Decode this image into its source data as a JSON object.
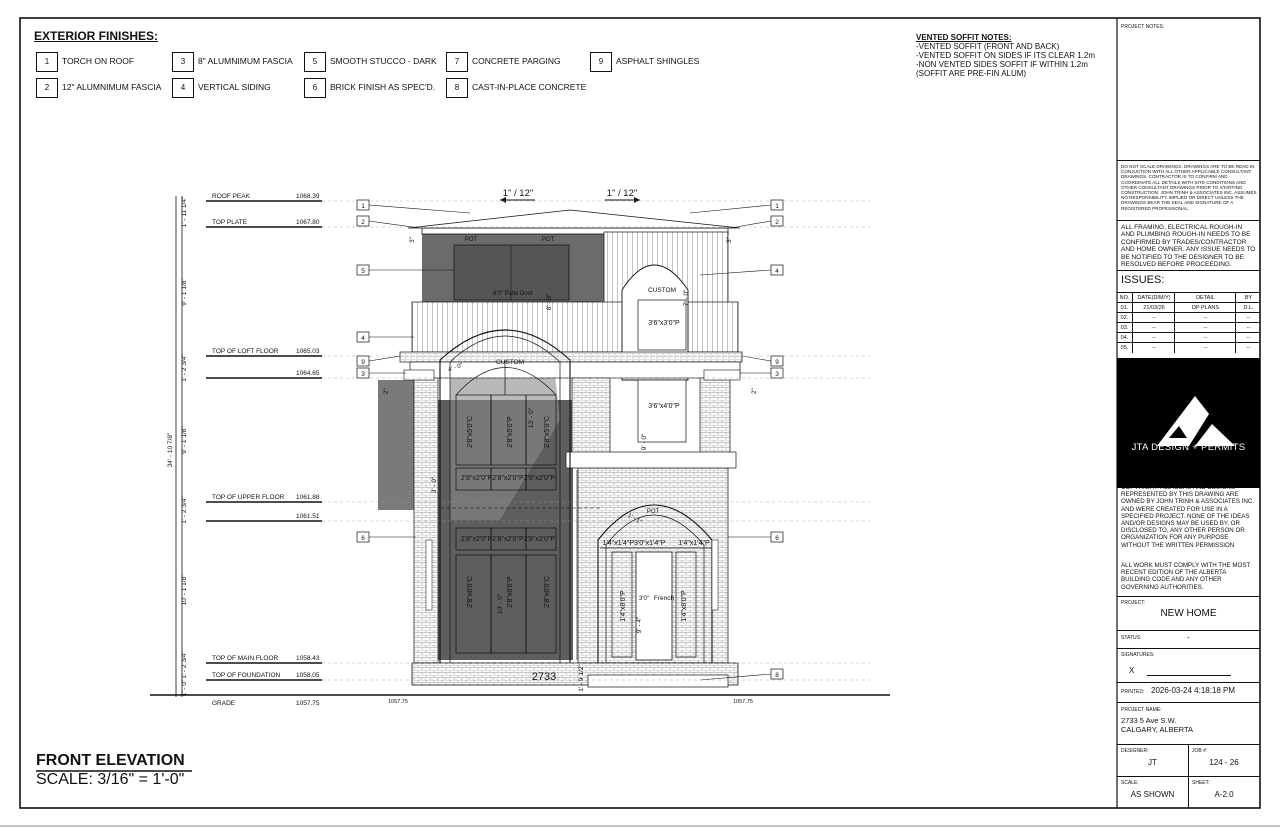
{
  "exterior_finishes": {
    "title": "EXTERIOR FINISHES:",
    "items": [
      {
        "num": "1",
        "label": "TORCH ON  ROOF"
      },
      {
        "num": "2",
        "label": "12\" ALUMNIMUM FASCIA"
      },
      {
        "num": "3",
        "label": "8\" ALUMNIMUM FASCIA"
      },
      {
        "num": "4",
        "label": "VERTICAL SIDING"
      },
      {
        "num": "5",
        "label": "SMOOTH STUCCO - DARK"
      },
      {
        "num": "6",
        "label": "BRICK FINISH AS SPEC'D."
      },
      {
        "num": "7",
        "label": "CONCRETE PARGING"
      },
      {
        "num": "8",
        "label": "CAST-IN-PLACE CONCRETE"
      },
      {
        "num": "9",
        "label": "ASPHALT SHINGLES"
      }
    ]
  },
  "soffit_notes": {
    "title": "VENTED SOFFIT NOTES:",
    "lines": [
      "-VENTED SOFFIT (FRONT AND BACK)",
      "-VENTED SOFFIT ON SIDES IF ITS CLEAR 1.2m",
      "-NON VENTED SIDES SOFFIT IF WITHIN 1.2m",
      "(SOFFIT ARE PRE-FIN ALUM)"
    ]
  },
  "drawing": {
    "title": "FRONT ELEVATION",
    "scale": "SCALE: 3/16\" = 1'-0\"",
    "address_number": "2733",
    "roof_slopes": [
      "1\" / 12\"",
      "1\" / 12\""
    ],
    "levels": [
      {
        "name": "ROOF PEAK",
        "elev": "1068.39"
      },
      {
        "name": "TOP PLATE",
        "elev": "1067.80"
      },
      {
        "name": "TOP OF LOFT FLOOR",
        "elev": "1065.03"
      },
      {
        "name": "",
        "elev": "1064.65"
      },
      {
        "name": "TOP OF UPPER FLOOR",
        "elev": "1061.88"
      },
      {
        "name": "",
        "elev": "1061.51"
      },
      {
        "name": "TOP OF MAIN FLOOR",
        "elev": "1058.43"
      },
      {
        "name": "TOP OF FOUNDATION",
        "elev": "1058.05"
      },
      {
        "name": "GRADE",
        "elev": "1057.75"
      }
    ],
    "grade_side_labels": [
      "1057.75",
      "1057.75"
    ],
    "dimensions": {
      "overall": "34' - 10 7/8\"",
      "roof": "1' - 11 1/4\"",
      "loft": "9' - 1 1/8\"",
      "loft_floor": "1' - 2 3/4\"",
      "upper": "9' - 1 1/8\"",
      "upper_floor": "1' - 2 3/4\"",
      "main": "10' - 1 1/8\"",
      "main_floor": "1' - 2 3/4\"",
      "foundation": "1' - 0\"",
      "entry_step": "1' - 9 1/2\""
    },
    "callouts_left": [
      "1",
      "2",
      "5",
      "4",
      "9",
      "3",
      "6"
    ],
    "callouts_right": [
      "1",
      "2",
      "4",
      "9",
      "3",
      "6",
      "8"
    ],
    "window_labels": {
      "patio_door": "8'0\" Patio Door",
      "pot1": "POT",
      "pot2": "POT",
      "pot3": "POT",
      "custom1": "CUSTOM",
      "custom2": "CUSTOM",
      "w_3x3": "3'6\"x3'0\"P",
      "w_3x4": "3'6\"x4'0\"P",
      "w_25c_a": "2'8\"x5'0\"C",
      "w_25p": "2'8\"x5'0\"P",
      "w_25c_b": "2'8\"x5'0\"C",
      "transom_row1": "2'8\"x2'0\"P2'8\"x2'0\"P2'8\"x2'0\"P",
      "transom_row2": "2'8\"x2'0\"P2'8\"x2'0\"P2'8\"x2'0\"P",
      "w_26c_a": "2'8\"x6'0\"C",
      "w_26p": "2'8\"x6'0\"P",
      "w_26c_b": "2'8\"x6'0\"C",
      "entry_transom": "1'4\"x1'4\"P3'0\"x1'4\"P",
      "entry_transom_r": "1'4\"x1'4\"P",
      "sidelite_l": "1'4\"x8'0\"P",
      "sidelite_r": "1'4\"x8'0\"P",
      "french": "French",
      "door_w": "3'0\"",
      "d_13": "13' - 0\"",
      "d_8": "8' - 0\"",
      "d_7": "7' - 0\"",
      "d_9": "9' - 0\"",
      "d_3": "3' - 0\"",
      "d_10": "10' - 0\"",
      "d_94": "9' - 4\"",
      "d_4": "4' - 0\"",
      "d_1": "1' - 1\"",
      "d_2a": "2\"",
      "d_2b": "2\"",
      "d_3a": "3\"",
      "d_3b": "3\""
    }
  },
  "title_block": {
    "project_notes_label": "PROJECT NOTES:",
    "disclaimer": "DO NOT SCALE DRAWINGS. DRAWINGS ARE TO BE READ IN CONJUCTION WITH ALL OTHER APPLICABLE CONSULTANT DRAWINGS. CONTRACTOR IS TO CONFIRM AND COORDINATE ALL DETAILS WITH SITE CONDITIONS AND OTHER CONSULTANT DRAWINGS PRIOR TO STARTING CONSTRUCTION. JOHN TRINH & ASSOCIATES INC. ASSUMES NO RESPONSIBILITY, IMPLIED OR DIRECT UNLESS THE DRAWINGS BEAR THE SEAL AND SIGNATURE OF A REGISTERED PROFESSIONAL.",
    "framing_note": "ALL FRAMING, ELECTRICAL ROUGH-IN AND PLUMBING ROUGH-IN NEEDS TO BE CONFIRMED BY TRADES/CONTRACTOR AND HOME OWNER. ANY ISSUE NEEDS TO BE NOTIFIED TO THE DESIGNER TO BE RESOLVED BEFORE PROCEEDING.",
    "issues_title": "ISSUES:",
    "issues_headers": [
      "NO.",
      "DATE(D/M/Y)",
      "DETAIL",
      "BY"
    ],
    "issues_rows": [
      [
        "01.",
        "21/03/26",
        "DP PLANS",
        "D.L."
      ],
      [
        "02.",
        "--",
        "--",
        "--"
      ],
      [
        "03.",
        "--",
        "--",
        "--"
      ],
      [
        "04.",
        "--",
        "--",
        "--"
      ],
      [
        "05.",
        "--",
        "--",
        "--"
      ]
    ],
    "logo_text": "JTA DESIGN + PERMITS",
    "copyright_1": "COPYRIGHT: ALL IDEAS AND DESIGNS REPRESENTED BY THIS DRAWING ARE OWNED BY JOHN TRINH & ASSOCIATES INC. AND WERE CREATED FOR USE IN A SPECIFIED PROJECT. NONE OF THE IDEAS AND/OR DESIGNS MAY BE USED BY, OR DISCLOSED TO, ANY OTHER PERSON OR ORGANIZATION FOR ANY PURPOSE WITHOUT THE WRITTEN PERMISSION",
    "copyright_2": "ALL WORK MUST COMPLY WITH THE MOST RECENT EDITION OF THE ALBERTA BUILDING CODE AND ANY OTHER GOVERNING AUTHORITIES.",
    "project_label": "PROJECT:",
    "project": "NEW HOME",
    "status_label": "STATUS:",
    "status": "-",
    "signatures_label": "SIGNATURES:",
    "signature_mark": "X",
    "printed_label": "PRINTED:",
    "printed": "2026-03-24 4:18:18 PM",
    "project_name_label": "PROJECT NAME:",
    "project_name_1": "2733 5 Ave S.W.",
    "project_name_2": "CALGARY, ALBERTA",
    "designer_label": "DESIGNER:",
    "designer": "JT",
    "job_label": "JOB #:",
    "job": "124 - 26",
    "scale_label": "SCALE:",
    "scale": "AS SHOWN",
    "sheet_label": "SHEET:",
    "sheet": "A-2.0"
  }
}
